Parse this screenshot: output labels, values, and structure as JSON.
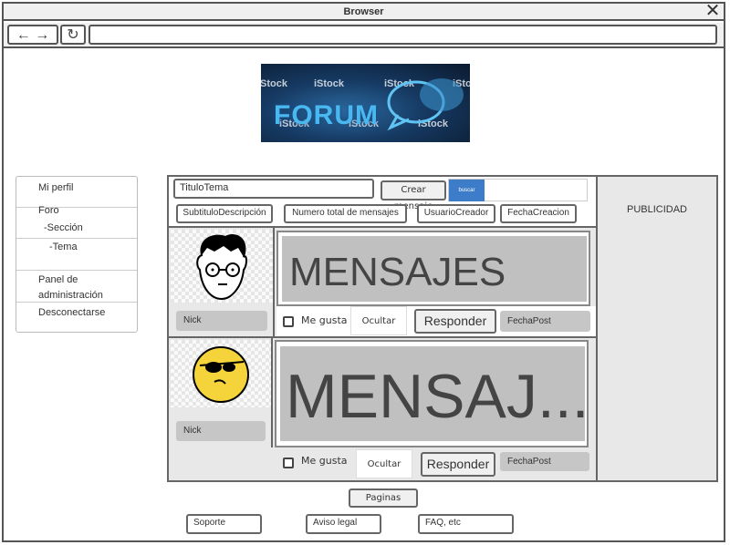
{
  "browser": {
    "title": "Browser",
    "close_icon": "close-icon",
    "back_icon": "arrow-left-icon",
    "forward_icon": "arrow-right-icon",
    "reload_icon": "reload-icon",
    "url": ""
  },
  "banner": {
    "brand": "iStock",
    "word": "FORUM"
  },
  "sidebar": {
    "items": [
      {
        "label": "Mi perfil"
      },
      {
        "label": "Foro"
      },
      {
        "label": "-Sección"
      },
      {
        "label": "-Tema"
      },
      {
        "label": "Panel de administración"
      },
      {
        "label": "Desconectarse"
      }
    ]
  },
  "topic": {
    "title": "TituloTema",
    "create_button": "Crear mensaje",
    "search_button": "buscar",
    "search_value": "",
    "chips": [
      "SubtituloDescripción",
      "Numero total de mensajes",
      "UsuarioCreador",
      "FechaCreacion"
    ]
  },
  "posts": [
    {
      "nick": "Nick",
      "message": "MENSAJES",
      "like": "Me gusta",
      "hide": "Ocultar",
      "reply": "Responder",
      "date": "FechaPost"
    },
    {
      "nick": "Nick",
      "message": "MENSAJ...",
      "like": "Me gusta",
      "hide": "Ocultar",
      "reply": "Responder",
      "date": "FechaPost"
    }
  ],
  "ads": {
    "label": "PUBLICIDAD"
  },
  "footer": {
    "pages": "Paginas",
    "support": "Soporte",
    "legal": "Aviso legal",
    "faq": "FAQ, etc"
  }
}
